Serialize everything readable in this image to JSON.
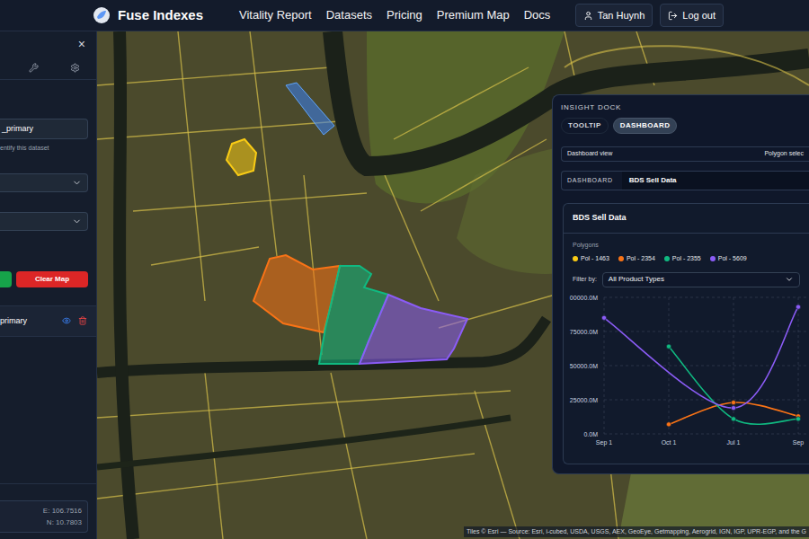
{
  "nav": {
    "logo": "Fuse Indexes",
    "links": [
      "Vitality Report",
      "Datasets",
      "Pricing",
      "Premium Map",
      "Docs"
    ],
    "user": "Tan Huynh",
    "logout": "Log out"
  },
  "sidebar": {
    "close": "×",
    "dataset_name": "_primary",
    "hint": "entify this dataset",
    "clear_button": "Clear Map",
    "layers": [
      {
        "name": "primary",
        "visible": true
      }
    ],
    "coords": {
      "e": "E: 106.7516",
      "n": "N: 10.7803"
    }
  },
  "map": {
    "attribution": "Tiles © Esri — Source: Esri, i-cubed, USDA, USGS, AEX, GeoEye, Getmapping, Aerogrid, IGN, IGP, UPR-EGP, and the G"
  },
  "dock": {
    "title": "INSIGHT DOCK",
    "tabs": [
      {
        "label": "TOOLTIP",
        "selected": false
      },
      {
        "label": "DASHBOARD",
        "selected": true
      }
    ],
    "view_label": "Dashboard view",
    "polygon_select": "Polygon selec",
    "section_label": "DASHBOARD",
    "dashboard_name": "BDS Sell Data",
    "card": {
      "title": "BDS Sell Data",
      "polygons_label": "Polygons",
      "filter_label": "Filter by:",
      "filter_value": "All Product Types",
      "chart": {
        "y_ticks": [
          "00000.0M",
          "75000.0M",
          "50000.0M",
          "25000.0M",
          "0.0M"
        ],
        "x_labels": [
          "Sep 1",
          "Oct 1",
          "Jul 1",
          "Sep"
        ],
        "series": [
          {
            "label": "Pol - 1463",
            "color": "#facc15",
            "values": []
          },
          {
            "label": "Pol - 2354",
            "color": "#f97316",
            "values": [
              null,
              7000,
              23000,
              13000
            ]
          },
          {
            "label": "Pol - 2355",
            "color": "#10b981",
            "values": [
              null,
              64000,
              11000,
              11000
            ]
          },
          {
            "label": "Pol - 5609",
            "color": "#8b5cf6",
            "values": [
              85000,
              null,
              19000,
              93000
            ]
          }
        ]
      }
    }
  }
}
